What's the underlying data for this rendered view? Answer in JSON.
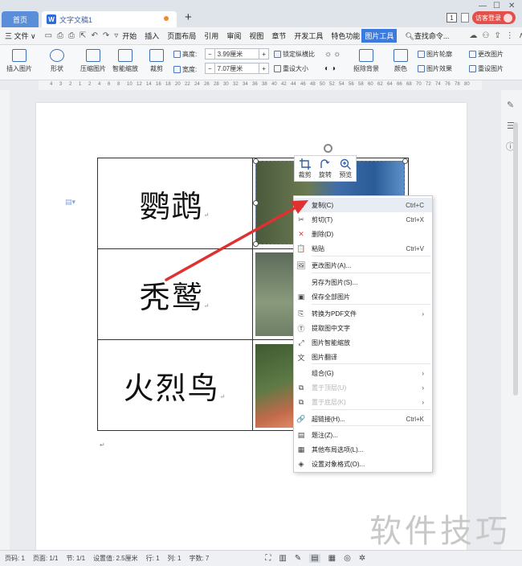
{
  "tabs": {
    "home": "首页",
    "doc": "文字文稿1"
  },
  "login": {
    "label": "访客登录",
    "badge": "1"
  },
  "menubar": {
    "file": "三 文件 ∨",
    "items": [
      "开始",
      "插入",
      "页面布局",
      "引用",
      "审阅",
      "视图",
      "章节",
      "开发工具",
      "特色功能",
      "图片工具"
    ],
    "active": "图片工具",
    "search": "查找命令..."
  },
  "ribbon": {
    "insert_picture": "插入图片",
    "shape": "形状",
    "compress": "压缩图片",
    "smart_scale": "智能缩放",
    "crop": "裁剪",
    "height_label": "高度:",
    "height_value": "3.99厘米",
    "width_label": "宽度:",
    "width_value": "7.07厘米",
    "lock_ratio": "锁定纵横比",
    "reset_size": "重设大小",
    "remove_bg": "抠除背景",
    "color": "颜色",
    "contour": "图片轮廓",
    "effect": "图片效果",
    "change_pic": "更改图片",
    "reset_pic": "重设图片"
  },
  "ruler_numbers": [
    "4",
    "3",
    "2",
    "1",
    "2",
    "4",
    "6",
    "8",
    "10",
    "12",
    "14",
    "16",
    "18",
    "20",
    "22",
    "24",
    "26",
    "28",
    "30",
    "32",
    "34",
    "36",
    "38",
    "40",
    "42",
    "44",
    "46",
    "48",
    "50",
    "52",
    "54",
    "56",
    "58",
    "60",
    "62",
    "64",
    "66",
    "68",
    "70",
    "72",
    "74",
    "76",
    "78",
    "80"
  ],
  "mini_toolbar": {
    "crop": "裁剪",
    "rotate": "旋转",
    "preview": "预览"
  },
  "table_rows": [
    "鹦鹉",
    "秃鹫",
    "火烈鸟"
  ],
  "context_menu": [
    {
      "label": "复制(C)",
      "shortcut": "Ctrl+C",
      "icon": "copy-icon",
      "glyph": "⧉"
    },
    {
      "label": "剪切(T)",
      "shortcut": "Ctrl+X",
      "icon": "cut-icon",
      "glyph": "✂"
    },
    {
      "label": "删除(D)",
      "shortcut": "",
      "icon": "delete-icon",
      "glyph": "✕"
    },
    {
      "label": "粘贴",
      "shortcut": "Ctrl+V",
      "icon": "paste-icon",
      "glyph": "📋"
    },
    {
      "label": "更改图片(A)...",
      "shortcut": "",
      "icon": "change-picture-icon",
      "glyph": "🖼"
    },
    {
      "label": "另存为图片(S)...",
      "shortcut": "",
      "icon": "",
      "glyph": ""
    },
    {
      "label": "保存全部图片",
      "shortcut": "",
      "icon": "save-all-icon",
      "glyph": "▣"
    },
    {
      "label": "转换为PDF文件",
      "shortcut": "›",
      "icon": "pdf-icon",
      "glyph": "⎘"
    },
    {
      "label": "提取图中文字",
      "shortcut": "",
      "icon": "ocr-icon",
      "glyph": "Ⓣ"
    },
    {
      "label": "图片智能缩放",
      "shortcut": "",
      "icon": "smart-scale-icon",
      "glyph": "⤢"
    },
    {
      "label": "图片翻译",
      "shortcut": "",
      "icon": "translate-icon",
      "glyph": "文"
    },
    {
      "label": "组合(G)",
      "shortcut": "›",
      "icon": "",
      "glyph": ""
    },
    {
      "label": "置于顶层(U)",
      "shortcut": "›",
      "icon": "bring-front-icon",
      "glyph": "⧉"
    },
    {
      "label": "置于底层(K)",
      "shortcut": "›",
      "icon": "send-back-icon",
      "glyph": "⧉"
    },
    {
      "label": "超链接(H)...",
      "shortcut": "Ctrl+K",
      "icon": "link-icon",
      "glyph": "🔗"
    },
    {
      "label": "题注(Z)...",
      "shortcut": "",
      "icon": "caption-icon",
      "glyph": "▤"
    },
    {
      "label": "其他布局选项(L)...",
      "shortcut": "",
      "icon": "layout-icon",
      "glyph": "▦"
    },
    {
      "label": "设置对象格式(O)...",
      "shortcut": "",
      "icon": "format-icon",
      "glyph": "◈"
    }
  ],
  "status": {
    "page": "页码: 1",
    "pages": "页面: 1/1",
    "section": "节: 1/1",
    "setting": "设置值: 2.5厘米",
    "row": "行: 1",
    "col": "列: 1",
    "words": "字数: 7"
  },
  "watermark": "软件技巧",
  "colors": {
    "accent": "#3b7be0",
    "login": "#e2504b",
    "arrow": "#e03030"
  }
}
